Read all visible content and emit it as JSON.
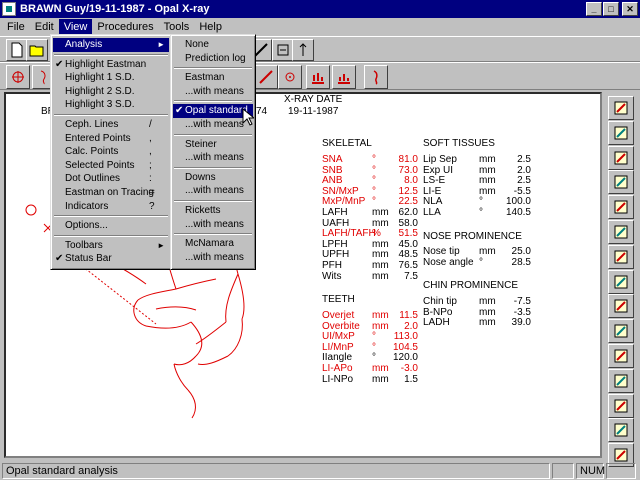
{
  "window": {
    "title": "BRAWN Guy/19-11-1987 - Opal X-ray"
  },
  "menubar": [
    "File",
    "Edit",
    "View",
    "Procedures",
    "Tools",
    "Help"
  ],
  "header": {
    "first_initial": "BR",
    "xray_date_label": "X-RAY DATE",
    "xray_date": "19-11-1987",
    "partial": "74"
  },
  "skeletal": {
    "title": "SKELETAL",
    "rows": [
      {
        "name": "SNA",
        "unit": "°",
        "value": "81.0",
        "color": "red"
      },
      {
        "name": "SNB",
        "unit": "°",
        "value": "73.0",
        "color": "red"
      },
      {
        "name": "ANB",
        "unit": "°",
        "value": "8.0",
        "color": "red"
      },
      {
        "name": "SN/MxP",
        "unit": "°",
        "value": "12.5",
        "color": "red"
      },
      {
        "name": "MxP/MnP",
        "unit": "°",
        "value": "22.5",
        "color": "red"
      },
      {
        "name": "LAFH",
        "unit": "mm",
        "value": "62.0",
        "color": "black"
      },
      {
        "name": "UAFH",
        "unit": "mm",
        "value": "58.0",
        "color": "black"
      },
      {
        "name": "LAFH/TAFH",
        "unit": "%",
        "value": "51.5",
        "color": "red"
      },
      {
        "name": "LPFH",
        "unit": "mm",
        "value": "45.0",
        "color": "black"
      },
      {
        "name": "UPFH",
        "unit": "mm",
        "value": "48.5",
        "color": "black"
      },
      {
        "name": "PFH",
        "unit": "mm",
        "value": "76.5",
        "color": "black"
      },
      {
        "name": "Wits",
        "unit": "mm",
        "value": "7.5",
        "color": "black"
      }
    ]
  },
  "teeth": {
    "title": "TEETH",
    "rows": [
      {
        "name": "Overjet",
        "unit": "mm",
        "value": "11.5",
        "color": "red"
      },
      {
        "name": "Overbite",
        "unit": "mm",
        "value": "2.0",
        "color": "red"
      },
      {
        "name": "UI/MxP",
        "unit": "°",
        "value": "113.0",
        "color": "red"
      },
      {
        "name": "LI/MnP",
        "unit": "°",
        "value": "104.5",
        "color": "red"
      },
      {
        "name": "IIangle",
        "unit": "°",
        "value": "120.0",
        "color": "black"
      },
      {
        "name": "LI-APo",
        "unit": "mm",
        "value": "-3.0",
        "color": "red"
      },
      {
        "name": "LI-NPo",
        "unit": "mm",
        "value": "1.5",
        "color": "black"
      }
    ]
  },
  "soft": {
    "title": "SOFT TISSUES",
    "rows": [
      {
        "name": "Lip Sep",
        "unit": "mm",
        "value": "2.5"
      },
      {
        "name": "Exp UI",
        "unit": "mm",
        "value": "2.0"
      },
      {
        "name": "LS-E",
        "unit": "mm",
        "value": "2.5"
      },
      {
        "name": "LI-E",
        "unit": "mm",
        "value": "-5.5"
      },
      {
        "name": "NLA",
        "unit": "°",
        "value": "100.0"
      },
      {
        "name": "LLA",
        "unit": "°",
        "value": "140.5"
      }
    ]
  },
  "nose": {
    "title": "NOSE PROMINENCE",
    "rows": [
      {
        "name": "Nose tip",
        "unit": "mm",
        "value": "25.0"
      },
      {
        "name": "Nose angle",
        "unit": "°",
        "value": "28.5"
      }
    ]
  },
  "chin": {
    "title": "CHIN PROMINENCE",
    "rows": [
      {
        "name": "Chin tip",
        "unit": "mm",
        "value": "-7.5"
      },
      {
        "name": "B-NPo",
        "unit": "mm",
        "value": "-3.5"
      },
      {
        "name": "LADH",
        "unit": "mm",
        "value": "39.0"
      }
    ]
  },
  "view_menu": [
    {
      "label": "Analysis",
      "arrow": "►",
      "highlight": true
    },
    {
      "sep": true
    },
    {
      "label": "Highlight Eastman",
      "check": "✔"
    },
    {
      "label": "Highlight 1 S.D."
    },
    {
      "label": "Highlight 2 S.D."
    },
    {
      "label": "Highlight 3 S.D."
    },
    {
      "sep": true
    },
    {
      "label": "Ceph. Lines",
      "shortcut": "/"
    },
    {
      "label": "Entered Points",
      "shortcut": ","
    },
    {
      "label": "Calc. Points",
      "shortcut": ","
    },
    {
      "label": "Selected Points",
      "shortcut": ";"
    },
    {
      "label": "Dot Outlines",
      "shortcut": ":"
    },
    {
      "label": "Eastman on Tracing",
      "shortcut": "="
    },
    {
      "label": "Indicators",
      "shortcut": "?"
    },
    {
      "sep": true
    },
    {
      "label": "Options..."
    },
    {
      "sep": true
    },
    {
      "label": "Toolbars",
      "arrow": "►"
    },
    {
      "label": "Status Bar",
      "check": "✔"
    }
  ],
  "analysis_menu": [
    {
      "label": "None"
    },
    {
      "label": "Prediction log"
    },
    {
      "sep": true
    },
    {
      "label": "Eastman"
    },
    {
      "label": "...with means"
    },
    {
      "sep": true
    },
    {
      "label": "Opal standard",
      "check": "✔",
      "highlight": true
    },
    {
      "label": "...with means"
    },
    {
      "sep": true
    },
    {
      "label": "Steiner"
    },
    {
      "label": "...with means"
    },
    {
      "sep": true
    },
    {
      "label": "Downs"
    },
    {
      "label": "...with means"
    },
    {
      "sep": true
    },
    {
      "label": "Ricketts"
    },
    {
      "label": "...with means"
    },
    {
      "sep": true
    },
    {
      "label": "McNamara"
    },
    {
      "label": "...with means"
    }
  ],
  "status": {
    "text": "Opal standard analysis",
    "num": "NUM"
  },
  "colors": {
    "titlebar": "#000080",
    "highlight": "#000080",
    "alert": "#e00000"
  }
}
